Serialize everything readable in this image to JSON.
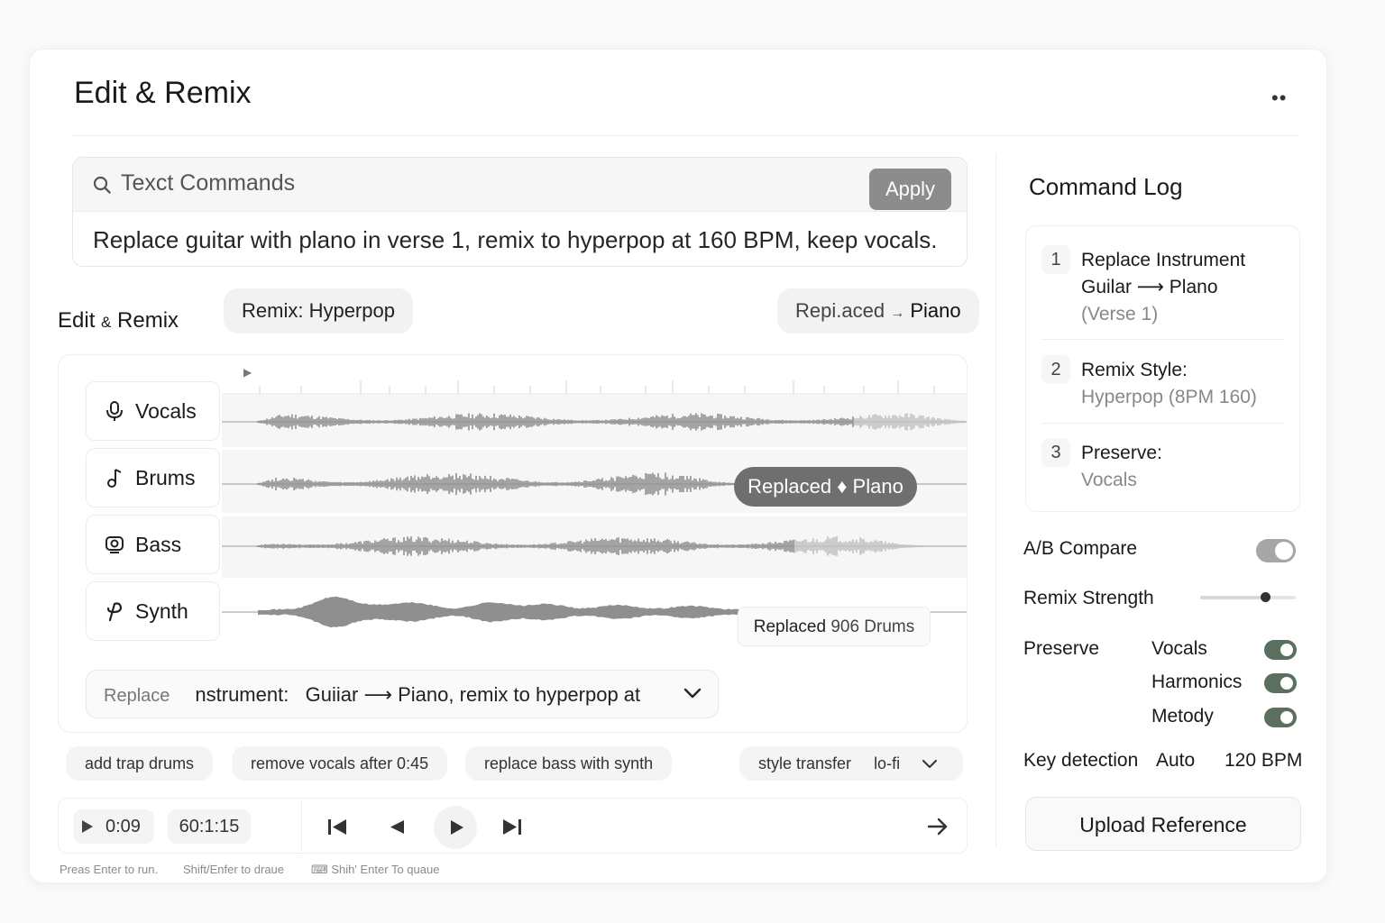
{
  "window": {
    "title": "Edit & Remix",
    "more_label": "••"
  },
  "commands": {
    "label": "Texct Commands",
    "apply_label": "Apply",
    "text": "Replace guitar with plano in verse 1, remix to hyperpop at 160 BPM, keep vocals."
  },
  "editor": {
    "title_a": "Edit",
    "title_amp": "&",
    "title_b": "Remix",
    "chip_remix_prefix": "Remix:",
    "chip_remix_value": "Hyperpop",
    "chip_replaced_prefix": "Repi.aced",
    "chip_replaced_arrow": "→",
    "chip_replaced_value": "Piano"
  },
  "tracks": [
    {
      "name": "Vocals",
      "icon": "microphone-icon"
    },
    {
      "name": "Brums",
      "icon": "music-note-icon"
    },
    {
      "name": "Bass",
      "icon": "speaker-icon"
    },
    {
      "name": "Synth",
      "icon": "synth-icon"
    }
  ],
  "badges": {
    "brums_replaced": "Replaced ♦ Plano",
    "synth_replaced_a": "Replaced",
    "synth_replaced_b": "906 Drums"
  },
  "dropdown": {
    "muted": "Replace",
    "instrument_label": "nstrument:",
    "text": "Guiiar ⟶ Piano, remix to hyperpop at"
  },
  "suggestions": [
    "add trap drums",
    "remove vocals after 0:45",
    "replace bass with synth"
  ],
  "style_transfer": {
    "label": "style transfer",
    "value": "lo-fi"
  },
  "transport": {
    "current_time": "0:09",
    "total_time": "60:1:15"
  },
  "hints": {
    "run": "Preas Enter to run.",
    "shift": "Shift/Enfer to draue",
    "queue": "Shih' Enter  To quaue"
  },
  "log": {
    "title": "Command Log",
    "items": [
      {
        "num": "1",
        "line1": "Replace Instrument",
        "line2": "Guilar ⟶  Plano",
        "line3": "(Verse 1)"
      },
      {
        "num": "2",
        "line1": "Remix Style:",
        "line2": "Hyperpop (8PM 160)"
      },
      {
        "num": "3",
        "line1": "Preserve:",
        "line2": "Vocals"
      }
    ]
  },
  "controls": {
    "ab_label": "A/B Compare",
    "strength_label": "Remix Strength",
    "strength_value": 0.68,
    "preserve_label": "Preserve",
    "preserve_items": [
      "Vocals",
      "Harmonics",
      "Metody"
    ],
    "key_label": "Key detection",
    "key_value": "Auto",
    "bpm_value": "120 BPM",
    "upload_label": "Upload Reference"
  }
}
